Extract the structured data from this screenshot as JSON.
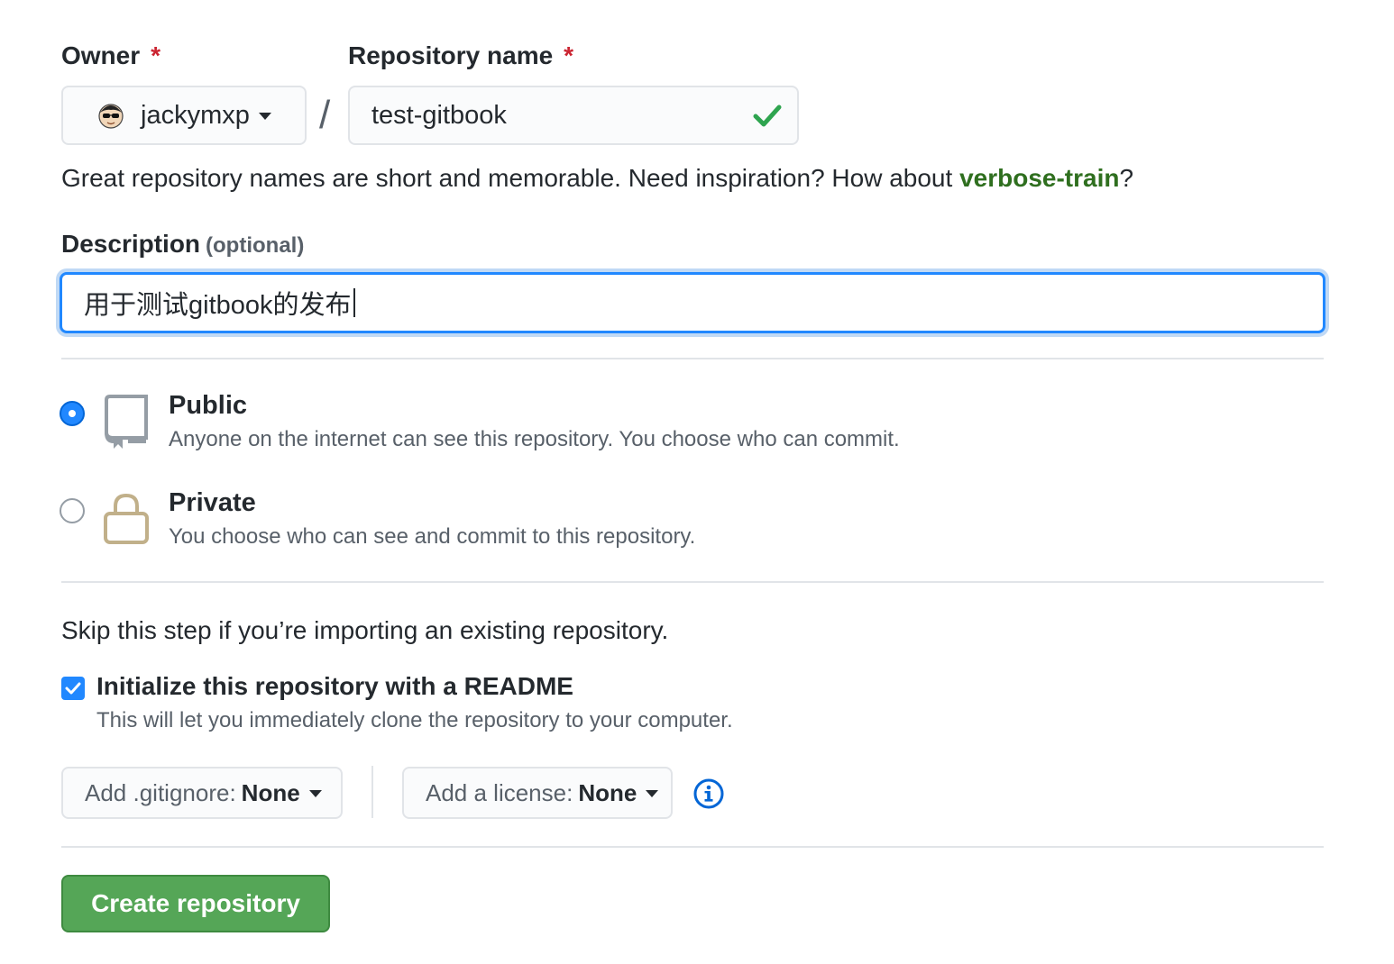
{
  "owner": {
    "label": "Owner",
    "required_mark": "*",
    "selected": "jackymxp",
    "avatar_icon": "avatar-icon"
  },
  "separator": "/",
  "repo_name": {
    "label": "Repository name",
    "required_mark": "*",
    "value": "test-gitbook",
    "valid_icon": "check-icon"
  },
  "hint": {
    "text": "Great repository names are short and memorable. Need inspiration? How about ",
    "suggestion": "verbose-train",
    "suffix": "?"
  },
  "description": {
    "label": "Description",
    "optional": "(optional)",
    "value": "用于测试gitbook的发布"
  },
  "visibility": {
    "public": {
      "title": "Public",
      "desc": "Anyone on the internet can see this repository. You choose who can commit.",
      "selected": true
    },
    "private": {
      "title": "Private",
      "desc": "You choose who can see and commit to this repository.",
      "selected": false
    }
  },
  "init": {
    "skip_text": "Skip this step if you’re importing an existing repository.",
    "readme_label": "Initialize this repository with a README",
    "readme_desc": "This will let you immediately clone the repository to your computer.",
    "readme_checked": true
  },
  "gitignore": {
    "label": "Add .gitignore:",
    "value": "None"
  },
  "license": {
    "label": "Add a license:",
    "value": "None"
  },
  "create_button": "Create repository",
  "colors": {
    "accent": "#2188ff",
    "required": "#cb2431",
    "success": "#28a745",
    "primary_button": "#55a657"
  }
}
